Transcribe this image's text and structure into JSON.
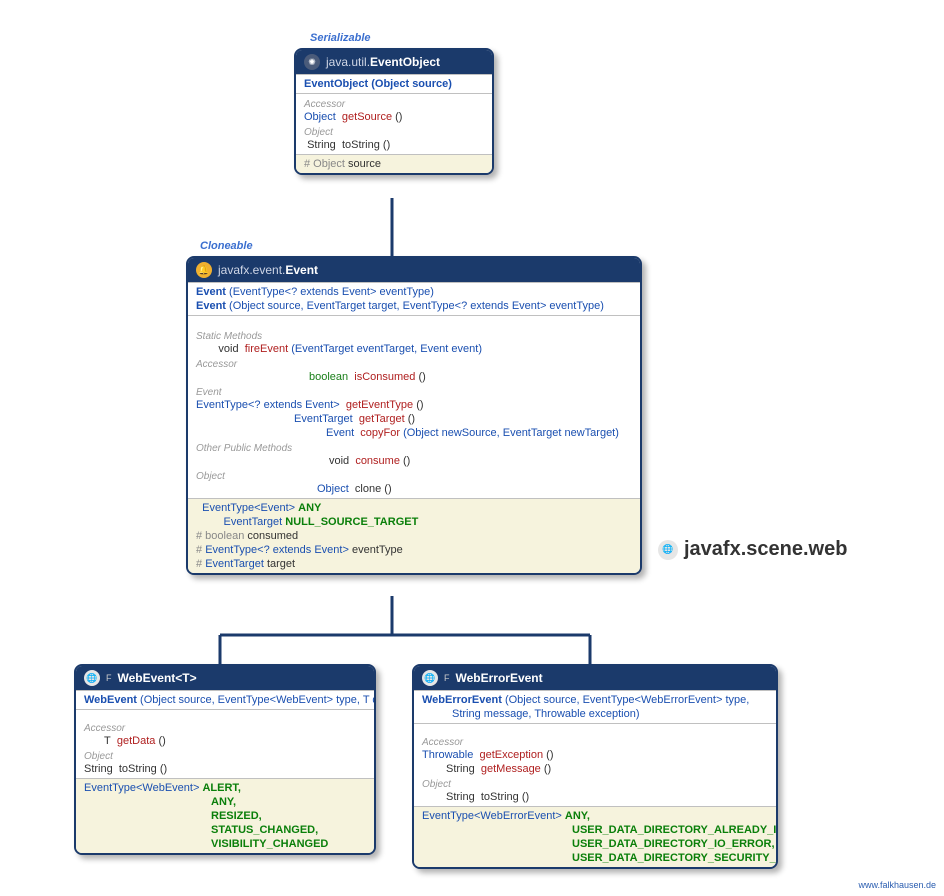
{
  "stereotypes": {
    "serializable": "Serializable",
    "cloneable": "Cloneable"
  },
  "packageTitle": "javafx.scene.web",
  "footer": "www.falkhausen.de",
  "eventObject": {
    "pkg": "java.util.",
    "name": "EventObject",
    "ctor": "EventObject (Object source)",
    "acc_label": "Accessor",
    "getSource_ret": "Object",
    "getSource": "getSource",
    "obj_label": "Object",
    "toString_ret": "String",
    "toString": "toString",
    "field_source_prefix": "# Object",
    "field_source": "source"
  },
  "event": {
    "pkg": "javafx.event.",
    "name": "Event",
    "ctor1_pre": "Event",
    "ctor1_args": "(EventType<? extends Event> eventType)",
    "ctor2_pre": "Event",
    "ctor2_args": "(Object source, EventTarget target, EventType<? extends Event> eventType)",
    "static_label": "Static Methods",
    "fireEvent_ret": "void",
    "fireEvent": "fireEvent",
    "fireEvent_args": "(EventTarget eventTarget, Event event)",
    "acc_label": "Accessor",
    "isConsumed_ret": "boolean",
    "isConsumed": "isConsumed",
    "event_label": "Event",
    "getEventType_ret": "EventType<? extends Event>",
    "getEventType": "getEventType",
    "getTarget_ret": "EventTarget",
    "getTarget": "getTarget",
    "copyFor_ret": "Event",
    "copyFor": "copyFor",
    "copyFor_args": "(Object newSource, EventTarget newTarget)",
    "other_label": "Other Public Methods",
    "consume_ret": "void",
    "consume": "consume",
    "obj_label": "Object",
    "clone_ret": "Object",
    "clone": "clone",
    "fields": {
      "any_type": "EventType<Event>",
      "any": "ANY",
      "nst_type": "EventTarget",
      "nst": "NULL_SOURCE_TARGET",
      "consumed_type": "# boolean",
      "consumed": "consumed",
      "eventType_type": "# EventType<? extends Event>",
      "eventType": "eventType",
      "target_type": "# EventTarget",
      "target": "target"
    }
  },
  "webEvent": {
    "name": "WebEvent<T>",
    "final": "F",
    "ctor_pre": "WebEvent",
    "ctor_args": "(Object source, EventType<WebEvent> type, T data)",
    "acc_label": "Accessor",
    "getData_ret": "T",
    "getData": "getData",
    "obj_label": "Object",
    "toString_ret": "String",
    "toString": "toString",
    "const_type": "EventType<WebEvent>",
    "consts": [
      "ALERT,",
      "ANY,",
      "RESIZED,",
      "STATUS_CHANGED,",
      "VISIBILITY_CHANGED"
    ]
  },
  "webErrorEvent": {
    "name": "WebErrorEvent",
    "final": "F",
    "ctor_pre": "WebErrorEvent",
    "ctor_args_l1": "(Object source, EventType<WebErrorEvent> type,",
    "ctor_args_l2": "String message, Throwable exception)",
    "acc_label": "Accessor",
    "getException_ret": "Throwable",
    "getException": "getException",
    "getMessage_ret": "String",
    "getMessage": "getMessage",
    "obj_label": "Object",
    "toString_ret": "String",
    "toString": "toString",
    "const_type": "EventType<WebErrorEvent>",
    "consts": [
      "ANY,",
      "USER_DATA_DIRECTORY_ALREADY_IN_USE,",
      "USER_DATA_DIRECTORY_IO_ERROR,",
      "USER_DATA_DIRECTORY_SECURITY_ERROR"
    ]
  }
}
